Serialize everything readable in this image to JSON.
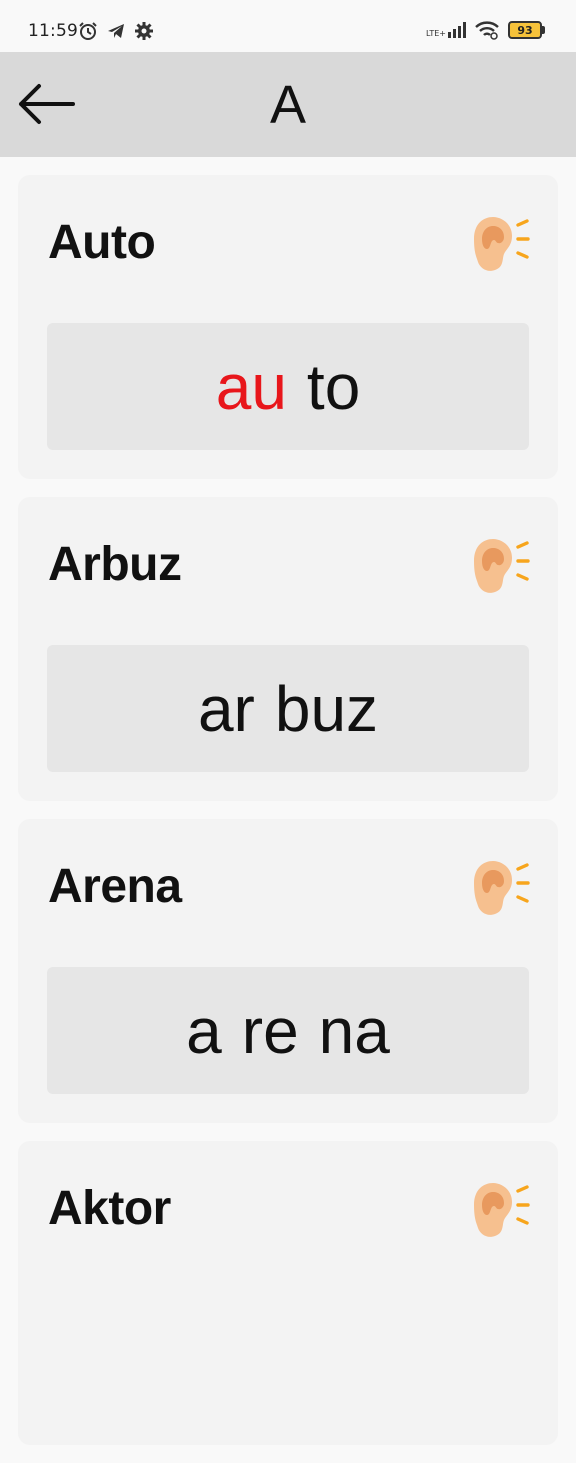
{
  "status_bar": {
    "time": "11:59",
    "network": "LTE+",
    "battery": "93",
    "icons": [
      "alarm-icon",
      "telegram-icon",
      "settings-icon",
      "signal-icon",
      "wifi-icon",
      "battery-icon"
    ]
  },
  "header": {
    "title": "A",
    "back_icon": "arrow-left-icon"
  },
  "cards": [
    {
      "word": "Auto",
      "syllables": [
        "au",
        "to"
      ],
      "highlighted_syllable_index": 0
    },
    {
      "word": "Arbuz",
      "syllables": [
        "ar",
        "buz"
      ],
      "highlighted_syllable_index": null
    },
    {
      "word": "Arena",
      "syllables": [
        "a",
        "re",
        "na"
      ],
      "highlighted_syllable_index": null
    },
    {
      "word": "Aktor",
      "syllables": [],
      "highlighted_syllable_index": null
    }
  ],
  "colors": {
    "highlight": "#e8161b",
    "app_bar": "#d9d9d9",
    "card": "#f3f3f3",
    "syllable_box": "#e6e6e6"
  }
}
